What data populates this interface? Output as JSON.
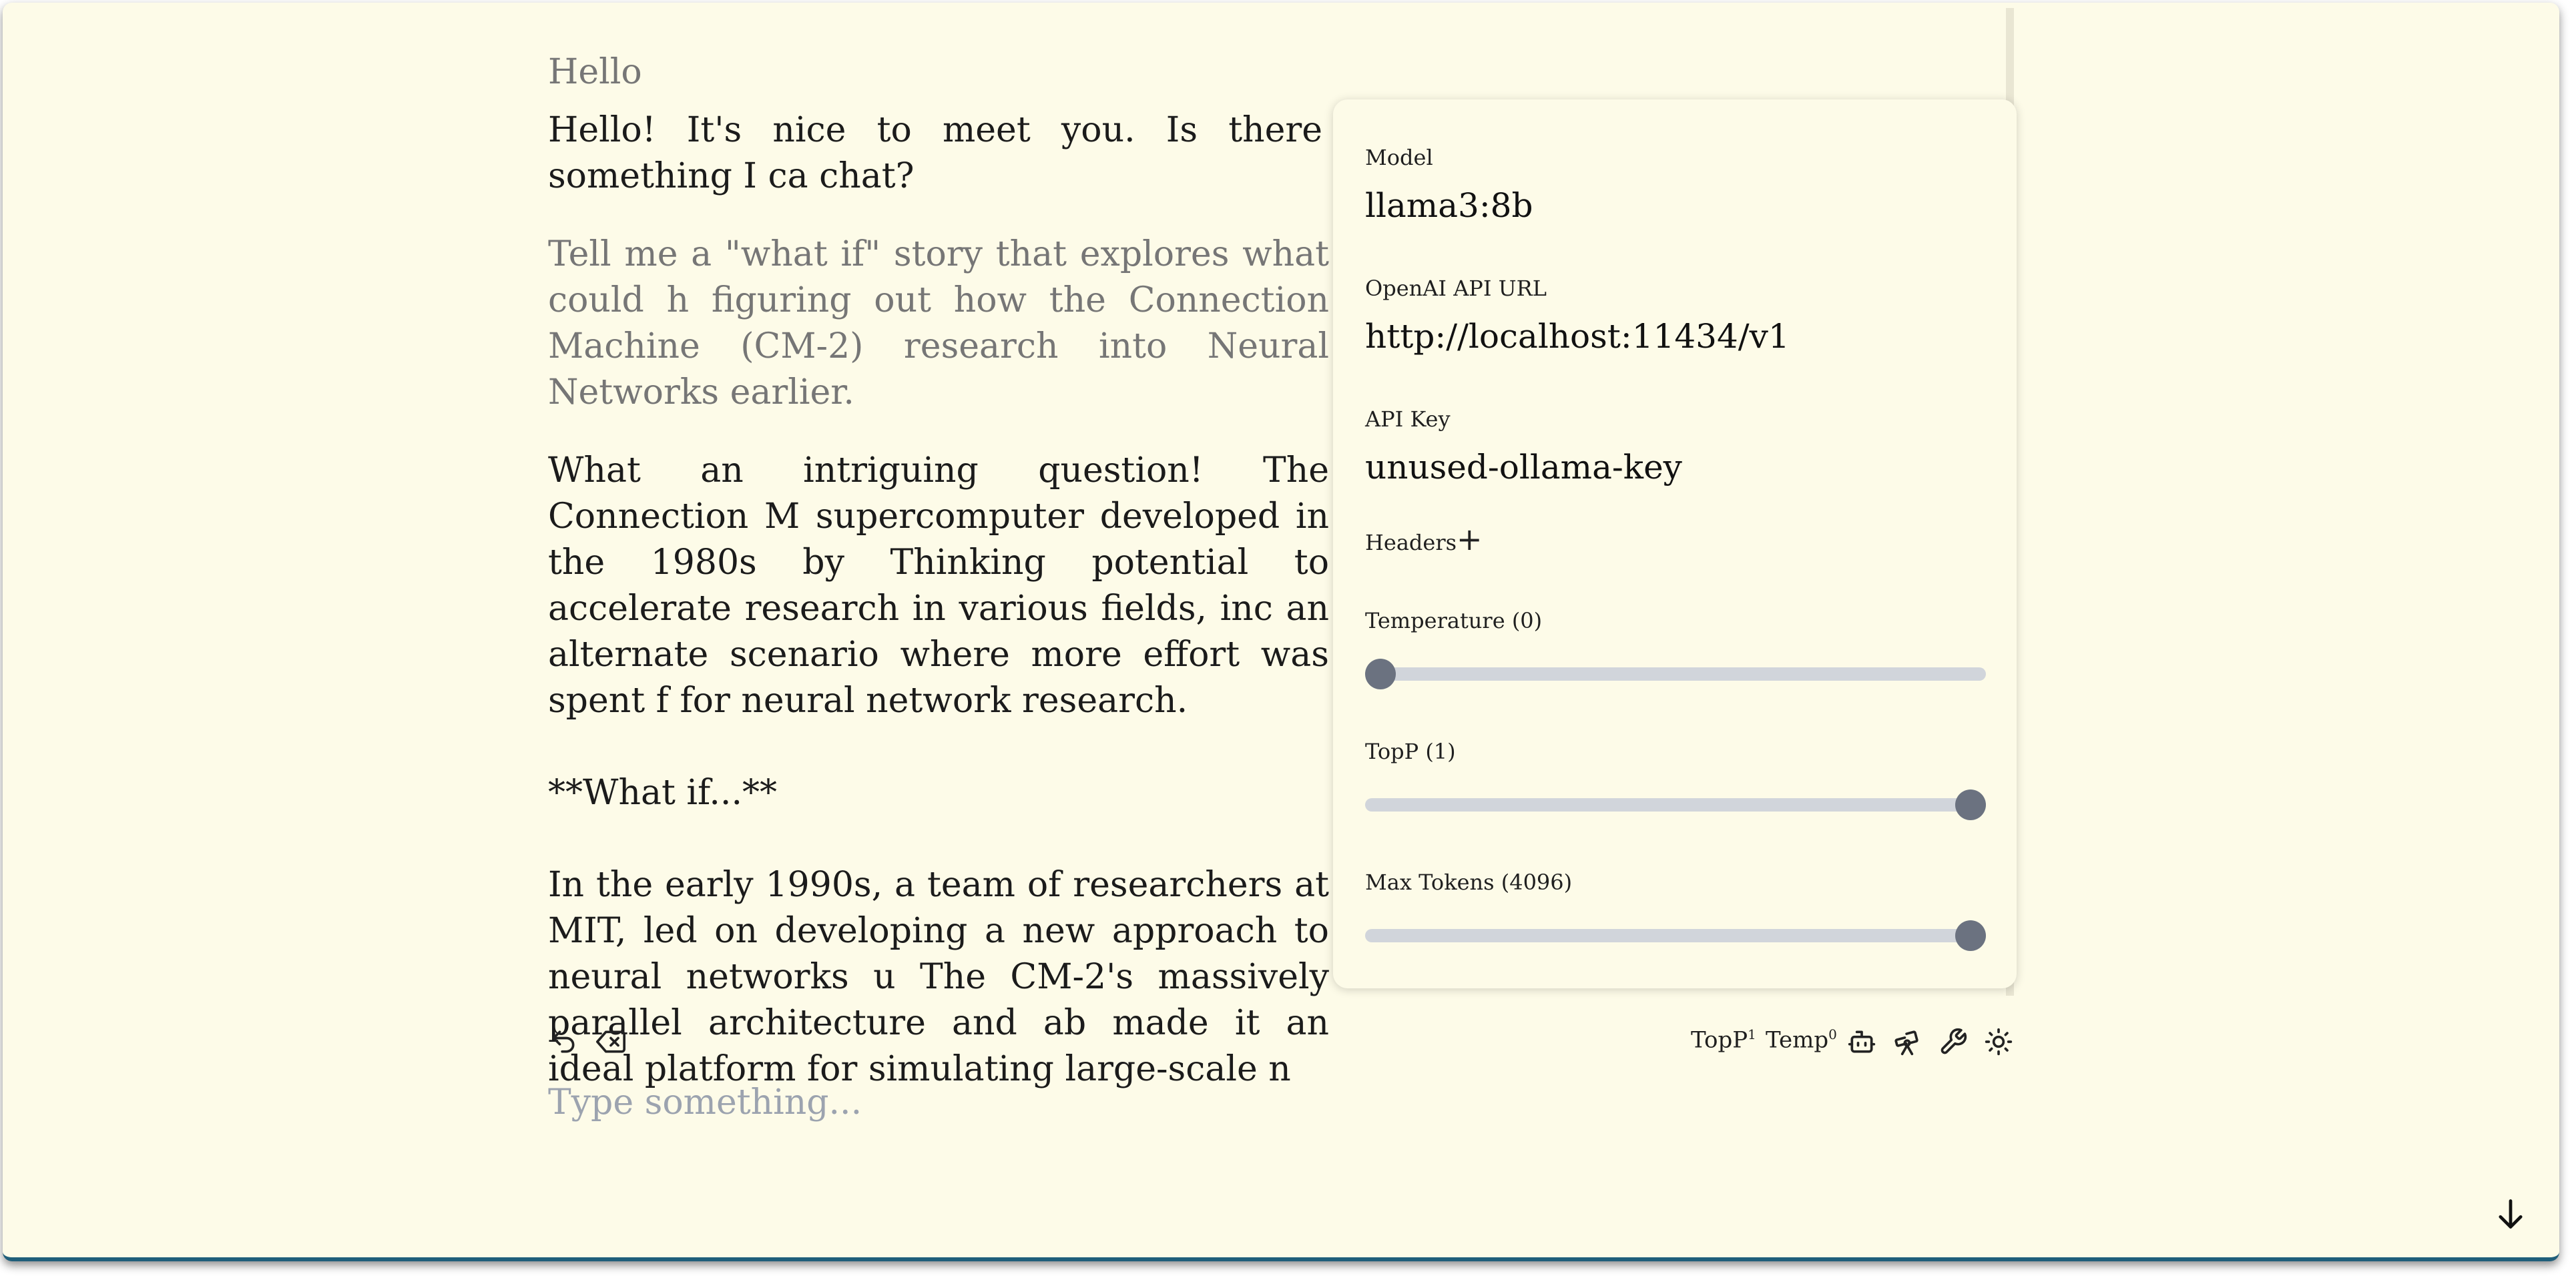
{
  "chat": {
    "messages": [
      {
        "role": "user",
        "text": "Hello"
      },
      {
        "role": "assistant",
        "text": "Hello! It's nice to meet you. Is there something I ca chat?"
      },
      {
        "role": "user",
        "text": "Tell me a \"what if\" story that explores what could h figuring out how the Connection Machine (CM-2) research into Neural Networks earlier."
      },
      {
        "role": "assistant",
        "text": "What an intriguing question! The Connection M supercomputer developed in the 1980s by Thinking potential to accelerate research in various fields, inc an alternate scenario where more effort was spent f for neural network research."
      },
      {
        "role": "assistant",
        "text": "**What if...**"
      },
      {
        "role": "assistant",
        "text": "In the early 1990s, a team of researchers at MIT, led on developing a new approach to neural networks u The CM-2's massively parallel architecture and ab made it an ideal platform for simulating large-scale n"
      }
    ]
  },
  "settings": {
    "model_label": "Model",
    "model_value": "llama3:8b",
    "api_url_label": "OpenAI API URL",
    "api_url_value": "http://localhost:11434/v1",
    "api_key_label": "API Key",
    "api_key_value": "unused-ollama-key",
    "headers_label": "Headers",
    "headers_add": "+",
    "temperature_label": "Temperature (0)",
    "temperature_value": 0,
    "temperature_max": 2,
    "topp_label": "TopP (1)",
    "topp_value": 1,
    "topp_max": 1,
    "max_tokens_label": "Max Tokens (4096)",
    "max_tokens_value": 4096,
    "max_tokens_max": 4096
  },
  "toolbar": {
    "left_icons": [
      "undo-icon",
      "clear-icon"
    ],
    "topp_text": "TopP",
    "topp_sup": "1",
    "temp_text": "Temp",
    "temp_sup": "0",
    "right_icons": [
      "robot-icon",
      "telescope-icon",
      "wrench-icon",
      "sun-icon"
    ]
  },
  "composer": {
    "placeholder": "Type something..."
  },
  "colors": {
    "background": "#fdfbe8",
    "slider_track": "#d1d5db",
    "slider_thumb": "#6b7280",
    "user_text": "#767676",
    "assistant_text": "#1b1b1b"
  }
}
